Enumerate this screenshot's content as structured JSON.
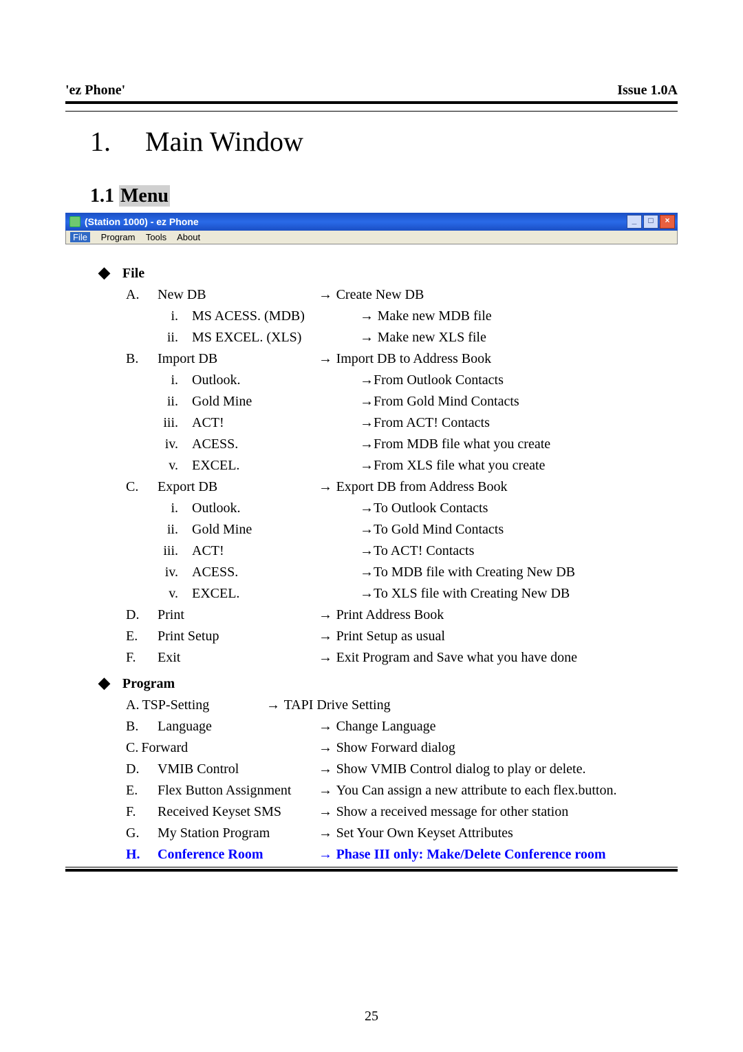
{
  "header": {
    "left": "'ez Phone'",
    "right": "Issue 1.0A"
  },
  "h1": {
    "num": "1.",
    "text": "Main Window"
  },
  "h2": {
    "num": "1.1",
    "text": "Menu"
  },
  "window": {
    "title": "(Station 1000) - ez Phone",
    "menus": {
      "file": "File",
      "program": "Program",
      "tools": "Tools",
      "about": "About"
    },
    "btns": {
      "min": "_",
      "max": "□",
      "close": "×"
    }
  },
  "sections": {
    "file": {
      "label": "File",
      "A": {
        "m": "A.",
        "l": "New DB",
        "d": "Create New DB"
      },
      "Ai": {
        "m": "i.",
        "l": "MS ACESS. (MDB)",
        "d": "Make new MDB file"
      },
      "Aii": {
        "m": "ii.",
        "l": "MS EXCEL. (XLS)",
        "d": "Make new XLS file"
      },
      "B": {
        "m": "B.",
        "l": "Import DB",
        "d": "Import DB to Address Book"
      },
      "Bi": {
        "m": "i.",
        "l": "Outlook.",
        "d": "From Outlook Contacts"
      },
      "Bii": {
        "m": "ii.",
        "l": "Gold Mine",
        "d": "From Gold Mind Contacts"
      },
      "Biii": {
        "m": "iii.",
        "l": "ACT!",
        "d": "From ACT! Contacts"
      },
      "Biv": {
        "m": "iv.",
        "l": "ACESS.",
        "d": "From MDB file what you create"
      },
      "Bv": {
        "m": "v.",
        "l": "EXCEL.",
        "d": "From XLS file what you create"
      },
      "C": {
        "m": "C.",
        "l": "Export DB",
        "d": "Export DB from Address Book"
      },
      "Ci": {
        "m": "i.",
        "l": "Outlook.",
        "d": "To Outlook Contacts"
      },
      "Cii": {
        "m": "ii.",
        "l": "Gold Mine",
        "d": "To Gold Mind Contacts"
      },
      "Ciii": {
        "m": "iii.",
        "l": "ACT!",
        "d": "To ACT! Contacts"
      },
      "Civ": {
        "m": "iv.",
        "l": "ACESS.",
        "d": "To MDB file with Creating New DB"
      },
      "Cv": {
        "m": "v.",
        "l": "EXCEL.",
        "d": "To XLS file with Creating New DB"
      },
      "D": {
        "m": "D.",
        "l": "Print",
        "d": "Print Address Book"
      },
      "E": {
        "m": "E.",
        "l": "Print Setup",
        "d": "Print Setup as usual"
      },
      "F": {
        "m": "F.",
        "l": "Exit",
        "d": "Exit Program and Save what you have done"
      }
    },
    "program": {
      "label": "Program",
      "A": {
        "m": "A.",
        "l": "TSP-Setting",
        "d": "TAPI Drive Setting"
      },
      "B": {
        "m": "B.",
        "l": "Language",
        "d": "Change Language"
      },
      "C": {
        "m": "C.",
        "l": "Forward",
        "d": "Show Forward dialog"
      },
      "D": {
        "m": "D.",
        "l": "VMIB Control",
        "d": "Show VMIB Control dialog to play or delete."
      },
      "E": {
        "m": "E.",
        "l": "Flex Button Assignment",
        "d": "You Can assign a new attribute to each flex.button."
      },
      "F": {
        "m": "F.",
        "l": "Received Keyset SMS",
        "d": "Show a received message for other station"
      },
      "G": {
        "m": "G.",
        "l": "My Station Program",
        "d": "Set Your Own Keyset Attributes"
      },
      "H": {
        "m": "H.",
        "l": "Conference Room",
        "d": "Phase III only: Make/Delete Conference room"
      }
    }
  },
  "footer": {
    "page": "25"
  }
}
